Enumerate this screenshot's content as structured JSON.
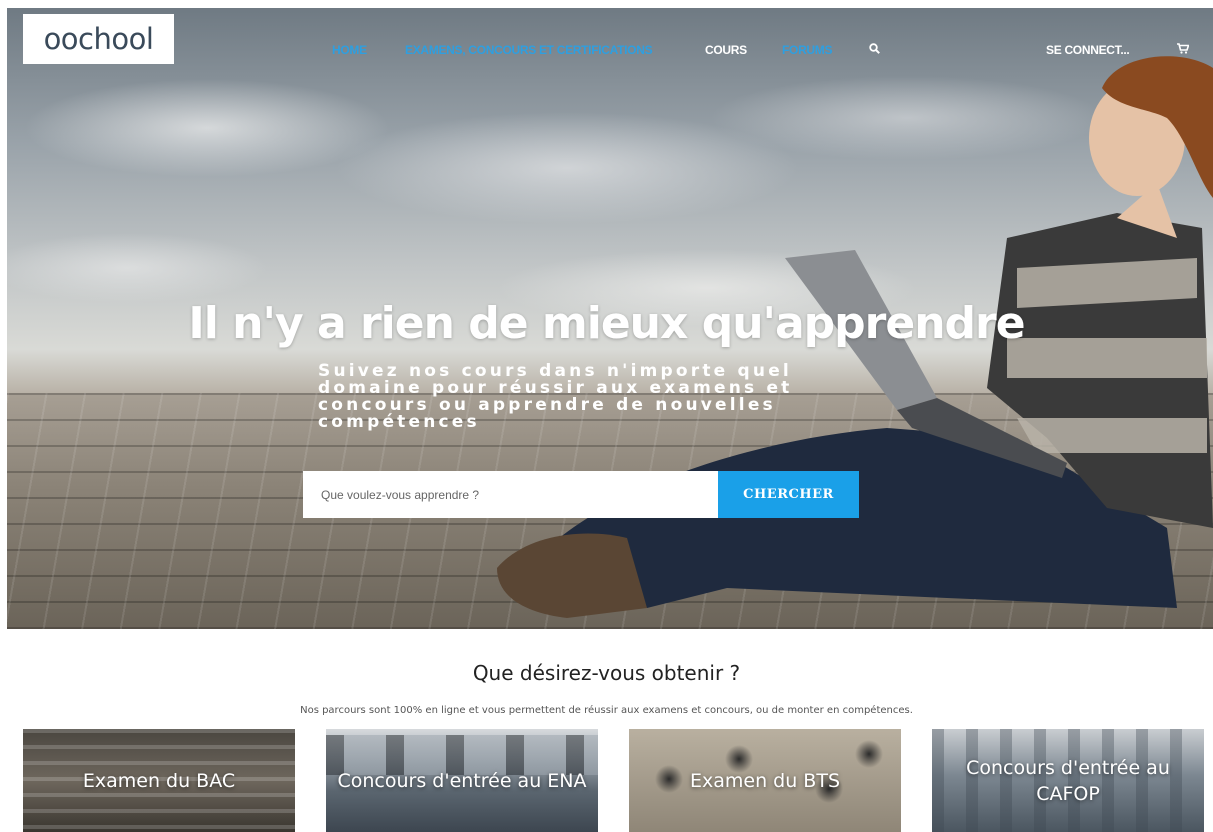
{
  "brand": {
    "logo_text": "oochool"
  },
  "nav": {
    "items": [
      {
        "label": "HOME",
        "color": "#2e9fe0"
      },
      {
        "label": "EXAMENS, CONCOURS ET CERTIFICATIONS",
        "color": "#2e9fe0"
      },
      {
        "label": "COURS",
        "color": "#ffffff"
      },
      {
        "label": "FORUMS",
        "color": "#2e9fe0"
      }
    ],
    "search_icon": "search-icon",
    "login_label": "SE CONNECT...",
    "cart_icon": "cart-icon"
  },
  "hero": {
    "title": "Il n'y a rien de mieux qu'apprendre",
    "subtitle": "Suivez nos cours dans n'importe quel domaine pour réussir aux examens et concours ou apprendre de nouvelles compétences",
    "search": {
      "placeholder": "Que voulez-vous apprendre ?",
      "button_label": "CHERCHER",
      "button_color": "#1aa0e8"
    }
  },
  "section": {
    "title": "Que désirez-vous obtenir ?",
    "subtitle": "Nos parcours sont 100% en ligne et vous permettent de réussir aux examens et concours, ou de monter en compétences.",
    "cards": [
      {
        "label": "Examen du BAC"
      },
      {
        "label": "Concours d'entrée au ENA"
      },
      {
        "label": "Examen du BTS"
      },
      {
        "label": "Concours d'entrée au CAFOP"
      }
    ]
  }
}
